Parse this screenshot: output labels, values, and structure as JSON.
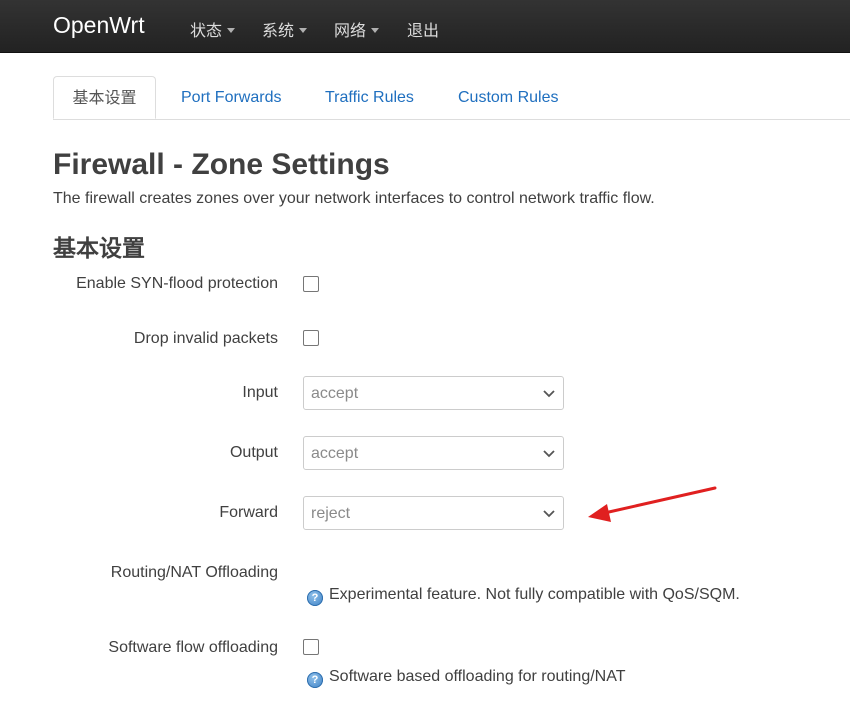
{
  "navbar": {
    "brand": "OpenWrt",
    "items": [
      {
        "label": "状态",
        "has_caret": true
      },
      {
        "label": "系统",
        "has_caret": true
      },
      {
        "label": "网络",
        "has_caret": true
      },
      {
        "label": "退出",
        "has_caret": false
      }
    ]
  },
  "tabs": [
    {
      "label": "基本设置",
      "active": true
    },
    {
      "label": "Port Forwards",
      "active": false
    },
    {
      "label": "Traffic Rules",
      "active": false
    },
    {
      "label": "Custom Rules",
      "active": false
    }
  ],
  "page": {
    "title": "Firewall - Zone Settings",
    "description": "The firewall creates zones over your network interfaces to control network traffic flow."
  },
  "section": {
    "title": "基本设置",
    "fields": {
      "syn_flood": {
        "label": "Enable SYN-flood protection",
        "checked": false
      },
      "drop_invalid": {
        "label": "Drop invalid packets",
        "checked": false
      },
      "input": {
        "label": "Input",
        "value": "accept"
      },
      "output": {
        "label": "Output",
        "value": "accept"
      },
      "forward": {
        "label": "Forward",
        "value": "reject"
      },
      "routing_nat": {
        "label": "Routing/NAT Offloading",
        "hint": "Experimental feature. Not fully compatible with QoS/SQM."
      },
      "software_offload": {
        "label": "Software flow offloading",
        "checked": false,
        "hint": "Software based offloading for routing/NAT"
      }
    }
  },
  "annotation": {
    "arrow_color": "#e02020"
  },
  "colors": {
    "navbar_bg": "#2c2c2c",
    "link": "#1f6fbf",
    "text": "#404040",
    "select_text": "#8a8a8a"
  }
}
